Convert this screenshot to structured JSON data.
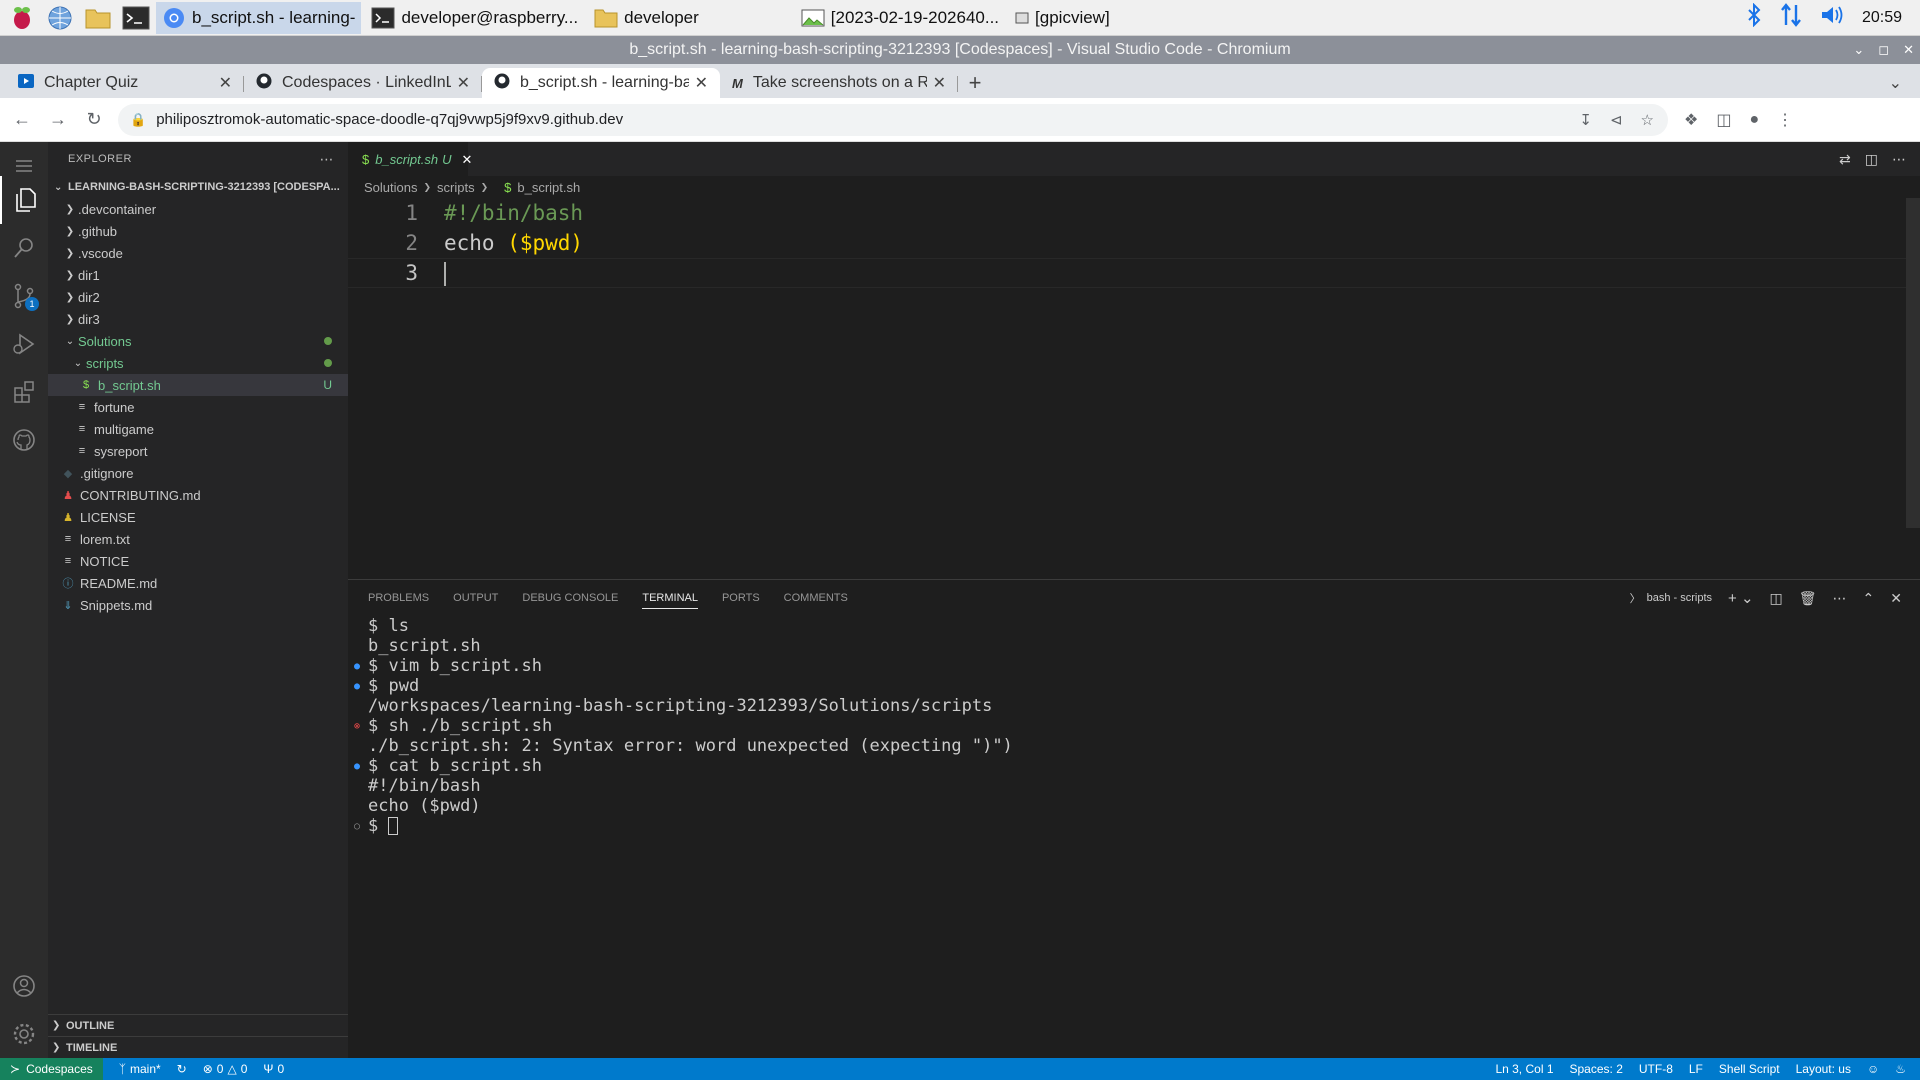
{
  "taskbar": {
    "tasks": [
      {
        "label": "b_script.sh - learning-",
        "icon": "chromium-icon",
        "active": true
      },
      {
        "label": "developer@raspberry...",
        "icon": "terminal-icon"
      },
      {
        "label": "developer",
        "icon": "folder-icon"
      },
      {
        "label": "[2023-02-19-202640...",
        "icon": "image-viewer-icon"
      },
      {
        "label": "[gpicview]",
        "icon": "window-icon"
      }
    ],
    "clock": "20:59"
  },
  "window": {
    "title": "b_script.sh - learning-bash-scripting-3212393 [Codespaces] - Visual Studio Code - Chromium"
  },
  "browser": {
    "tabs": [
      {
        "title": "Chapter Quiz"
      },
      {
        "title": "Codespaces · LinkedInLe"
      },
      {
        "title": "b_script.sh - learning-bas"
      },
      {
        "title": "Take screenshots on a R"
      }
    ],
    "url": "philiposztromok-automatic-space-doodle-q7qj9vwp5j9f9xv9.github.dev"
  },
  "explorer": {
    "header": "EXPLORER",
    "root": "LEARNING-BASH-SCRIPTING-3212393 [CODESPA...",
    "items": [
      {
        "label": ".devcontainer"
      },
      {
        "label": ".github"
      },
      {
        "label": ".vscode"
      },
      {
        "label": "dir1"
      },
      {
        "label": "dir2"
      },
      {
        "label": "dir3"
      },
      {
        "label": "Solutions"
      },
      {
        "label": "scripts"
      },
      {
        "label": "b_script.sh",
        "status": "U"
      },
      {
        "label": "fortune"
      },
      {
        "label": "multigame"
      },
      {
        "label": "sysreport"
      },
      {
        "label": ".gitignore"
      },
      {
        "label": "CONTRIBUTING.md"
      },
      {
        "label": "LICENSE"
      },
      {
        "label": "lorem.txt"
      },
      {
        "label": "NOTICE"
      },
      {
        "label": "README.md"
      },
      {
        "label": "Snippets.md"
      }
    ],
    "outline": "OUTLINE",
    "timeline": "TIMELINE"
  },
  "editor": {
    "tab": {
      "name": "b_script.sh",
      "status": "U"
    },
    "breadcrumb": [
      "Solutions",
      "scripts",
      "b_script.sh"
    ],
    "lines": [
      {
        "num": "1",
        "text": "#!/bin/bash"
      },
      {
        "num": "2",
        "pre": "echo ",
        "arg": "($pwd)"
      },
      {
        "num": "3",
        "text": ""
      }
    ]
  },
  "panel": {
    "tabs": [
      "PROBLEMS",
      "OUTPUT",
      "DEBUG CONSOLE",
      "TERMINAL",
      "PORTS",
      "COMMENTS"
    ],
    "terminal_name": "bash - scripts",
    "lines": [
      "$ ls",
      "b_script.sh",
      "$ vim b_script.sh",
      "$ pwd",
      "/workspaces/learning-bash-scripting-3212393/Solutions/scripts",
      "$ sh ./b_script.sh",
      "./b_script.sh: 2: Syntax error: word unexpected (expecting \")\")",
      "$ cat b_script.sh",
      "#!/bin/bash",
      "echo ($pwd)",
      "$ "
    ]
  },
  "status": {
    "remote": "Codespaces",
    "branch": "main*",
    "errors": "0",
    "warnings": "0",
    "ports": "0",
    "position": "Ln 3, Col 1",
    "spaces": "Spaces: 2",
    "encoding": "UTF-8",
    "eol": "LF",
    "language": "Shell Script",
    "layout": "Layout: us"
  },
  "colors": {
    "accent": "#007acc",
    "remote": "#16825d",
    "git_untracked": "#73c991"
  }
}
